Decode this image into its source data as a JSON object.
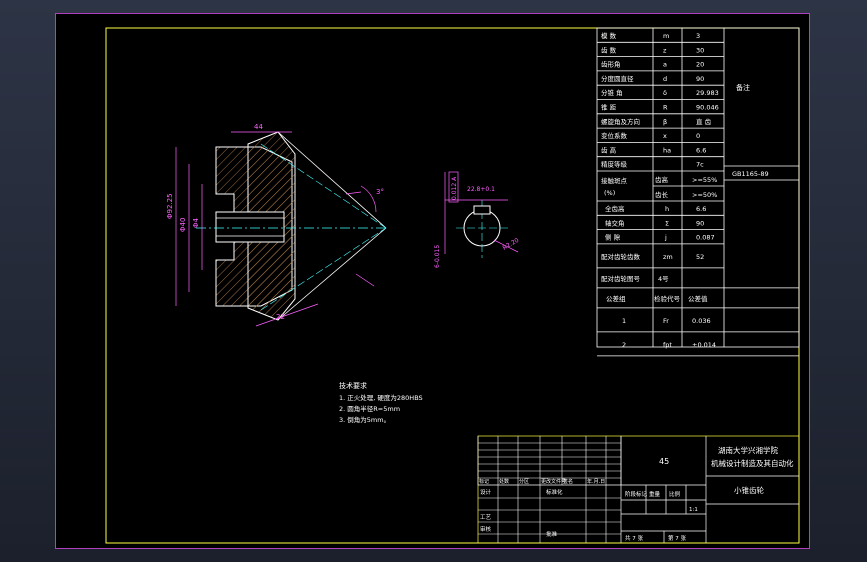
{
  "params": [
    {
      "name": "模  数",
      "sym": "m",
      "val": "3"
    },
    {
      "name": "齿  数",
      "sym": "z",
      "val": "30"
    },
    {
      "name": "齿形角",
      "sym": "a",
      "val": "20"
    },
    {
      "name": "分度圆直径",
      "sym": "d",
      "val": "90"
    },
    {
      "name": "分锥  角",
      "sym": "δ",
      "val": "29.983"
    },
    {
      "name": "锥  距",
      "sym": "R",
      "val": "90.046"
    },
    {
      "name": "螺旋角及方向",
      "sym": "β",
      "val": "直  齿"
    },
    {
      "name": "变位系数",
      "sym": "x",
      "val": "0"
    },
    {
      "name": "齿  高",
      "sym": "ha",
      "val": "6.6"
    },
    {
      "name": "精度等级",
      "sym": "",
      "val": "7c"
    }
  ],
  "standard": "GB1165-89",
  "remark_label": "备注",
  "contact": {
    "label1": "接触斑点",
    "label2": "(%)",
    "h_label": "齿高",
    "h_val": ">=55%",
    "l_label": "齿长",
    "l_val": ">=50%"
  },
  "more_params": [
    {
      "name": "全齿高",
      "sym": "h",
      "val": "6.6"
    },
    {
      "name": "轴交角",
      "sym": "Σ",
      "val": "90"
    },
    {
      "name": "侧  隙",
      "sym": "j",
      "val": "0.087"
    }
  ],
  "mating": {
    "count_label": "配对齿轮齿数",
    "count_sym": "zm",
    "count_val": "52",
    "no_label": "配对齿轮图号",
    "no_val": "4号"
  },
  "tolerance_header": {
    "group": "公差组",
    "code": "检验代号",
    "value": "公差值"
  },
  "tolerance_rows": [
    {
      "group": "1",
      "code": "Fr",
      "value": "0.036"
    },
    {
      "group": "2",
      "code": "fpt",
      "value": "±0.014"
    }
  ],
  "tech_req": {
    "title": "技术要求",
    "lines": [
      "1.  正火处理,  硬度为280HBS",
      "2.  圆角半径R=5mm",
      "3.  倒角为5mm。"
    ]
  },
  "title_block": {
    "school1": "湖南大学兴湘学院",
    "school2": "机械设计制造及其自动化",
    "material": "45",
    "part_name": "小锥齿轮",
    "row_labels": [
      "标记",
      "处数",
      "分区",
      "更改文件号",
      "签名",
      "年.月.日"
    ],
    "design": "设计",
    "check": "审核",
    "process": "工艺",
    "standardize": "标准化",
    "stage": "阶段标记",
    "weight": "重量",
    "scale_label": "比例",
    "scale": "1:1",
    "sheets": "共  7  张",
    "sheet_no": "第  7  张",
    "approve": "批准"
  },
  "dims": {
    "d_outer": "Φ92.25",
    "d_mid": "Φ40",
    "d_inner": "Φ4",
    "w_top": "44",
    "w_bot": "22",
    "angle": "3°",
    "key_w": "22.8",
    "key_label": "22.8+0.1",
    "tol1": "0.012 A",
    "r_label": "R2.20",
    "key_bot": "6-0.015"
  },
  "colors": {
    "frame": "#ffff40",
    "lines": "#ffffff",
    "hatch": "#a07040",
    "dim": "#ff60ff",
    "center": "#40ffff"
  }
}
